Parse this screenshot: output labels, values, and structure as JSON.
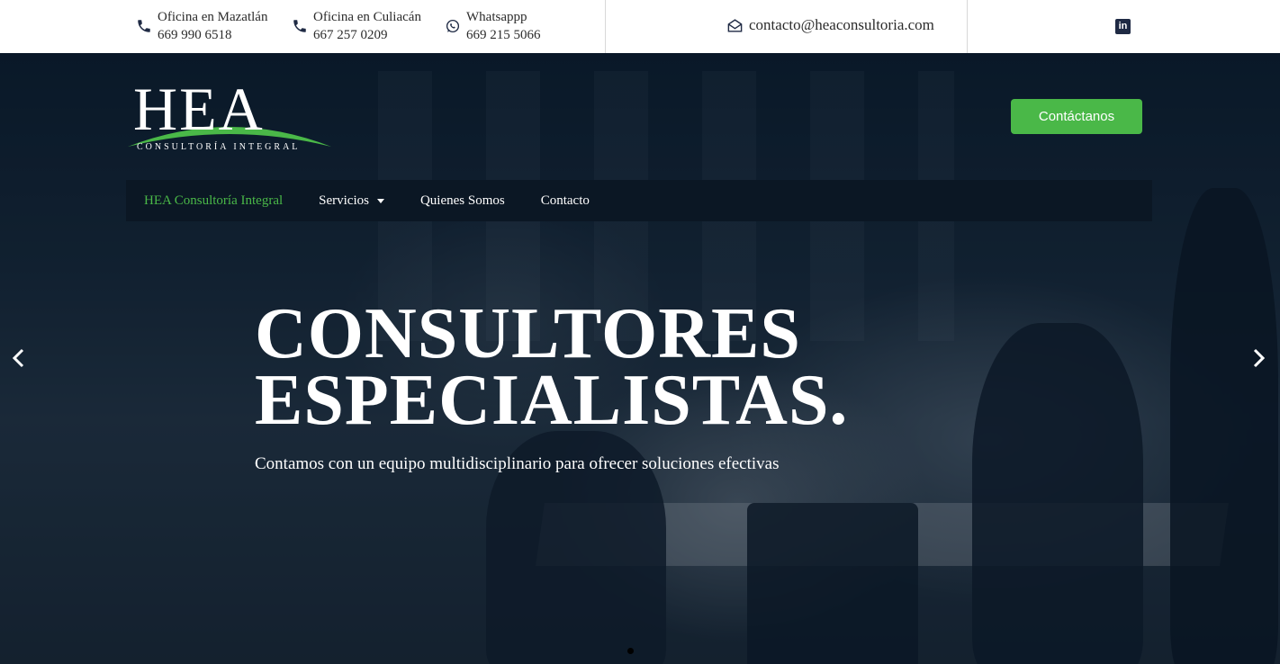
{
  "topbar": {
    "contacts": [
      {
        "icon": "phone-icon",
        "label": "Oficina en Mazatlán",
        "number": "669 990 6518"
      },
      {
        "icon": "phone-icon",
        "label": "Oficina en Culiacán",
        "number": "667 257 0209"
      },
      {
        "icon": "whatsapp-icon",
        "label": "Whatsappp",
        "number": "669 215 5066"
      }
    ],
    "email": {
      "icon": "envelope-icon",
      "address": "contacto@heaconsultoria.com"
    },
    "social": {
      "icon": "linkedin-icon",
      "glyph": "in"
    }
  },
  "logo": {
    "letters": "HEA",
    "subtitle": "CONSULTORÍA INTEGRAL",
    "arc_color": "#4ab848"
  },
  "cta": {
    "label": "Contáctanos"
  },
  "nav": {
    "items": [
      {
        "label": "HEA Consultoría Integral",
        "active": true
      },
      {
        "label": "Servicios",
        "has_dropdown": true
      },
      {
        "label": "Quienes Somos"
      },
      {
        "label": "Contacto"
      }
    ]
  },
  "hero": {
    "headline_line1": "CONSULTORES",
    "headline_line2": "ESPECIALISTAS.",
    "subheadline": "Contamos con un equipo multidisciplinario para ofrecer soluciones efectivas",
    "prev_icon": "chevron-left-icon",
    "next_icon": "chevron-right-icon"
  },
  "colors": {
    "accent": "#4ab848",
    "nav_bg": "#0b1724",
    "icon": "#1f2a44"
  }
}
